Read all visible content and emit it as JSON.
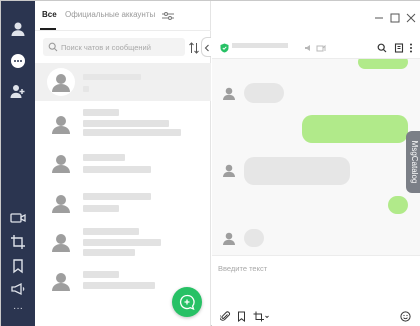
{
  "rail": {
    "items": [
      {
        "icon": "profile-icon"
      },
      {
        "icon": "chats-icon"
      },
      {
        "icon": "add-friend-icon"
      },
      {
        "icon": "video-call-icon"
      },
      {
        "icon": "screenshot-crop-icon"
      },
      {
        "icon": "bookmark-icon"
      },
      {
        "icon": "announcement-icon"
      },
      {
        "icon": "more-icon"
      }
    ],
    "more_label": "···"
  },
  "tabs": {
    "all_label": "Все",
    "official_label": "Официальные аккаунты"
  },
  "search": {
    "placeholder": "Поиск чатов и сообщений"
  },
  "chat_list": {
    "row_count": 6
  },
  "composer": {
    "placeholder": "Введите текст"
  },
  "side_tab": {
    "label": "MsgCatalog"
  },
  "colors": {
    "rail": "#2b3550",
    "accent_green": "#27c165",
    "bubble_out": "#b1ea8a",
    "bubble_in": "#e6e6e6",
    "side_tab": "#7b7f87"
  }
}
